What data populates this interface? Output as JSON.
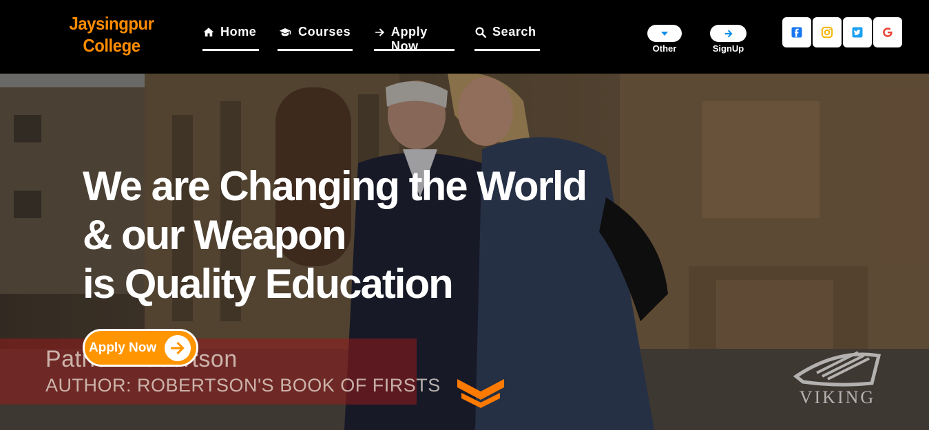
{
  "brand": {
    "line1": "Jaysingpur",
    "line2": "College",
    "color": "#ff8c00"
  },
  "nav": {
    "items": [
      {
        "label": "Home",
        "icon": "home-icon"
      },
      {
        "label": "Courses",
        "icon": "graduation-cap-icon"
      },
      {
        "label": "Apply Now",
        "icon": "arrow-right-icon"
      },
      {
        "label": "Search",
        "icon": "search-icon"
      }
    ]
  },
  "header_buttons": {
    "other": {
      "label": "Other",
      "icon": "caret-down-icon"
    },
    "signup": {
      "label": "SignUp",
      "icon": "arrow-right-icon"
    }
  },
  "social": [
    {
      "name": "facebook-icon",
      "color": "#1877f2"
    },
    {
      "name": "instagram-icon",
      "color": "#f5b400"
    },
    {
      "name": "twitter-icon",
      "color": "#1da1f2"
    },
    {
      "name": "google-icon",
      "color": "#ea4335"
    }
  ],
  "hero": {
    "title_lines": [
      "We are Changing the World",
      "& our Weapon",
      "is Quality Education"
    ],
    "cta_label": "Apply Now",
    "accent": "#ff9500",
    "video_caption": {
      "name": "Patrick Robertson",
      "role": "AUTHOR: ROBERTSON'S BOOK OF FIRSTS"
    },
    "watermark": "VIKING"
  }
}
